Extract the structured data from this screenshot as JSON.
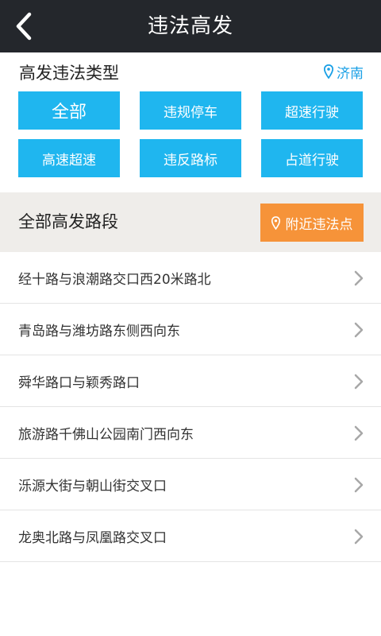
{
  "header": {
    "title": "违法高发"
  },
  "types": {
    "heading": "高发违法类型",
    "city": "济南",
    "buttons": [
      "全部",
      "违规停车",
      "超速行驶",
      "高速超速",
      "违反路标",
      "占道行驶"
    ]
  },
  "roads": {
    "title": "全部高发路段",
    "nearby_label": "附近违法点",
    "items": [
      "经十路与浪潮路交口西20米路北",
      "青岛路与潍坊路东侧西向东",
      "舜华路口与颖秀路口",
      "旅游路千佛山公园南门西向东",
      "泺源大街与朝山街交叉口",
      "龙奥北路与凤凰路交叉口"
    ]
  },
  "colors": {
    "topbar": "#24272c",
    "type_button": "#1fb6ef",
    "nearby_button": "#f69339",
    "city_text": "#1aa0e6",
    "section_bg": "#efedea"
  },
  "icons": {
    "back": "back-arrow-icon",
    "city": "location-pin-icon",
    "nearby": "location-pin-icon",
    "row": "chevron-right-icon"
  }
}
